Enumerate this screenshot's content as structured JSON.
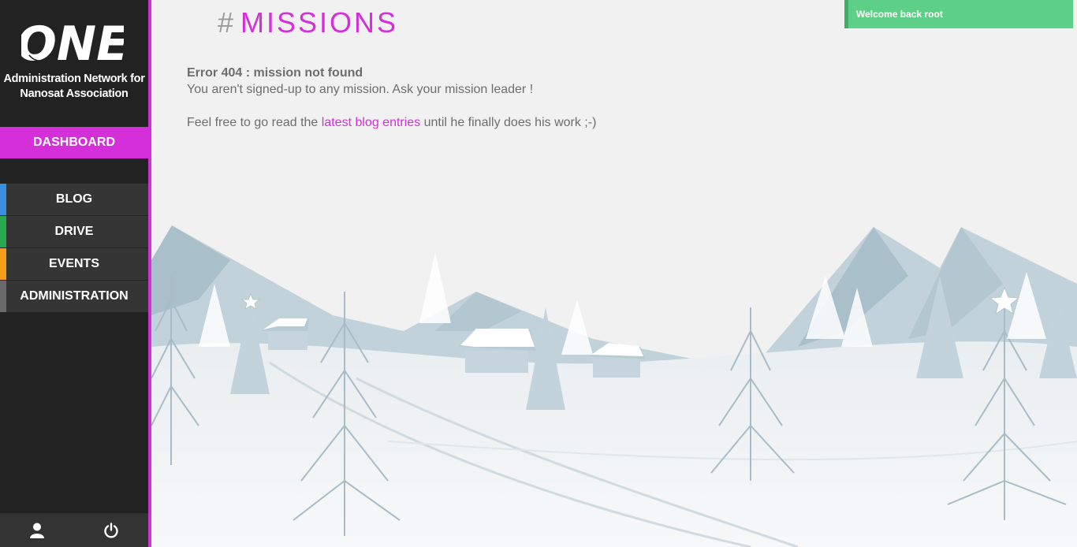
{
  "brand": {
    "logo_text": "ONE",
    "subtitle_line1": "Administration Network for",
    "subtitle_line2": "Nanosat Association"
  },
  "sidebar": {
    "dashboard_label": "DASHBOARD",
    "items": [
      {
        "label": "BLOG",
        "stripe_color": "#3a8ee0"
      },
      {
        "label": "DRIVE",
        "stripe_color": "#2aa84f"
      },
      {
        "label": "EVENTS",
        "stripe_color": "#f59d1a"
      },
      {
        "label": "ADMINISTRATION",
        "stripe_color": "#6a6a6a"
      }
    ],
    "footer": {
      "profile_icon": "user-icon",
      "logout_icon": "power-icon"
    }
  },
  "header": {
    "hash": "#",
    "title": "MISSIONS"
  },
  "content": {
    "error_title": "Error 404 : mission not found",
    "error_message": "You aren't signed-up to any mission. Ask your mission leader !",
    "blog_prefix": "Feel free to go read the ",
    "blog_link": "latest blog entries",
    "blog_suffix": " until he finally does his work ;-)"
  },
  "notification": {
    "message": "Welcome back root"
  },
  "colors": {
    "accent": "#d42fd8",
    "sidebar_bg": "#222222",
    "nav_item_bg": "#353535",
    "toast_bg": "#5ecf86"
  }
}
